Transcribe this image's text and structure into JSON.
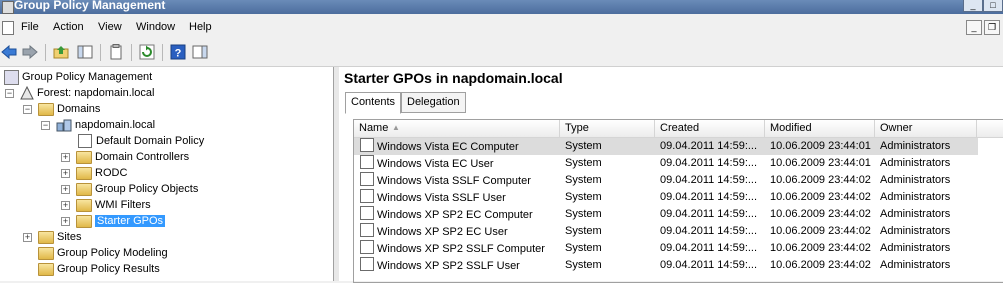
{
  "window": {
    "title": "Group Policy Management"
  },
  "menu": {
    "items": [
      "File",
      "Action",
      "View",
      "Window",
      "Help"
    ]
  },
  "toolbar": {
    "icons": [
      "back-icon",
      "forward-icon",
      "up-folder-icon",
      "show-hide-tree-icon",
      "properties-icon",
      "refresh-icon",
      "help-icon",
      "show-hide-action-pane-icon"
    ]
  },
  "tree": {
    "root": "Group Policy Management",
    "forest": "Forest: napdomain.local",
    "domains": "Domains",
    "domain": "napdomain.local",
    "default_policy": "Default Domain Policy",
    "domain_controllers": "Domain Controllers",
    "rodc": "RODC",
    "gpo_objects": "Group Policy Objects",
    "wmi_filters": "WMI Filters",
    "starter_gpos": "Starter GPOs",
    "sites": "Sites",
    "modeling": "Group Policy Modeling",
    "results": "Group Policy Results"
  },
  "main": {
    "heading": "Starter GPOs in napdomain.local",
    "tabs": [
      "Contents",
      "Delegation"
    ],
    "columns": [
      "Name",
      "Type",
      "Created",
      "Modified",
      "Owner"
    ],
    "rows": [
      [
        "Windows Vista EC Computer",
        "System",
        "09.04.2011 14:59:...",
        "10.06.2009 23:44:01",
        "Administrators"
      ],
      [
        "Windows Vista EC User",
        "System",
        "09.04.2011 14:59:...",
        "10.06.2009 23:44:01",
        "Administrators"
      ],
      [
        "Windows Vista SSLF Computer",
        "System",
        "09.04.2011 14:59:...",
        "10.06.2009 23:44:02",
        "Administrators"
      ],
      [
        "Windows Vista SSLF User",
        "System",
        "09.04.2011 14:59:...",
        "10.06.2009 23:44:02",
        "Administrators"
      ],
      [
        "Windows XP SP2 EC Computer",
        "System",
        "09.04.2011 14:59:...",
        "10.06.2009 23:44:02",
        "Administrators"
      ],
      [
        "Windows XP SP2 EC User",
        "System",
        "09.04.2011 14:59:...",
        "10.06.2009 23:44:02",
        "Administrators"
      ],
      [
        "Windows XP SP2 SSLF Computer",
        "System",
        "09.04.2011 14:59:...",
        "10.06.2009 23:44:02",
        "Administrators"
      ],
      [
        "Windows XP SP2 SSLF User",
        "System",
        "09.04.2011 14:59:...",
        "10.06.2009 23:44:02",
        "Administrators"
      ]
    ]
  }
}
